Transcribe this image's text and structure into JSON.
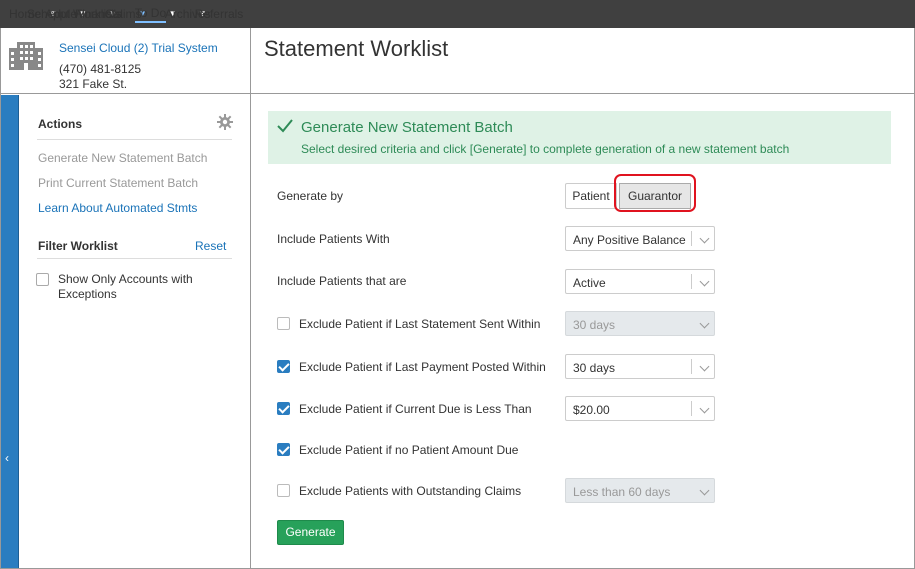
{
  "nav": {
    "items": [
      {
        "label": "Home",
        "dropdown": false
      },
      {
        "label": "Schedule",
        "dropdown": false
      },
      {
        "label": "Appt Worklists",
        "dropdown": true
      },
      {
        "label": "Financial",
        "dropdown": true
      },
      {
        "label": "Claims",
        "dropdown": true
      },
      {
        "label": "To Do",
        "dropdown": true,
        "active": true
      },
      {
        "label": "Archives",
        "dropdown": true
      },
      {
        "label": "Referrals",
        "dropdown": true
      }
    ]
  },
  "practice": {
    "name": "Sensei Cloud (2) Trial System",
    "phone": "(470) 481-8125",
    "address": "321 Fake St."
  },
  "page": {
    "title": "Statement Worklist"
  },
  "sidebar": {
    "actions_heading": "Actions",
    "actions": [
      {
        "label": "Generate New Statement Batch",
        "enabled": false
      },
      {
        "label": "Print Current Statement Batch",
        "enabled": false
      },
      {
        "label": "Learn About Automated Stmts",
        "enabled": true
      }
    ],
    "filter_heading": "Filter Worklist",
    "reset_label": "Reset",
    "filter_exceptions": {
      "label": "Show Only Accounts with Exceptions",
      "checked": false
    }
  },
  "banner": {
    "title": "Generate New Statement Batch",
    "subtitle": "Select desired criteria and click [Generate] to complete generation of a new statement batch"
  },
  "form": {
    "generate_by": {
      "label": "Generate by",
      "options": [
        "Patient",
        "Guarantor"
      ],
      "selected": "Guarantor"
    },
    "include_with": {
      "label": "Include Patients With",
      "value": "Any Positive Balance"
    },
    "include_status": {
      "label": "Include Patients that are",
      "value": "Active"
    },
    "excl_last_statement": {
      "label": "Exclude Patient if Last Statement Sent Within",
      "checked": false,
      "value": "30 days"
    },
    "excl_last_payment": {
      "label": "Exclude Patient if Last Payment Posted Within",
      "checked": true,
      "value": "30 days"
    },
    "excl_current_due": {
      "label": "Exclude Patient if Current Due is Less Than",
      "checked": true,
      "value": "$20.00"
    },
    "excl_no_amount": {
      "label": "Exclude Patient if no Patient Amount Due",
      "checked": true
    },
    "excl_claims": {
      "label": "Exclude Patients with Outstanding Claims",
      "checked": false,
      "value": "Less than 60 days"
    },
    "generate_label": "Generate"
  },
  "colors": {
    "nav_bg": "#404040",
    "accent": "#2a7dc0",
    "success": "#27a15a",
    "banner_bg": "#dff2e6",
    "highlight": "#e0131f"
  }
}
